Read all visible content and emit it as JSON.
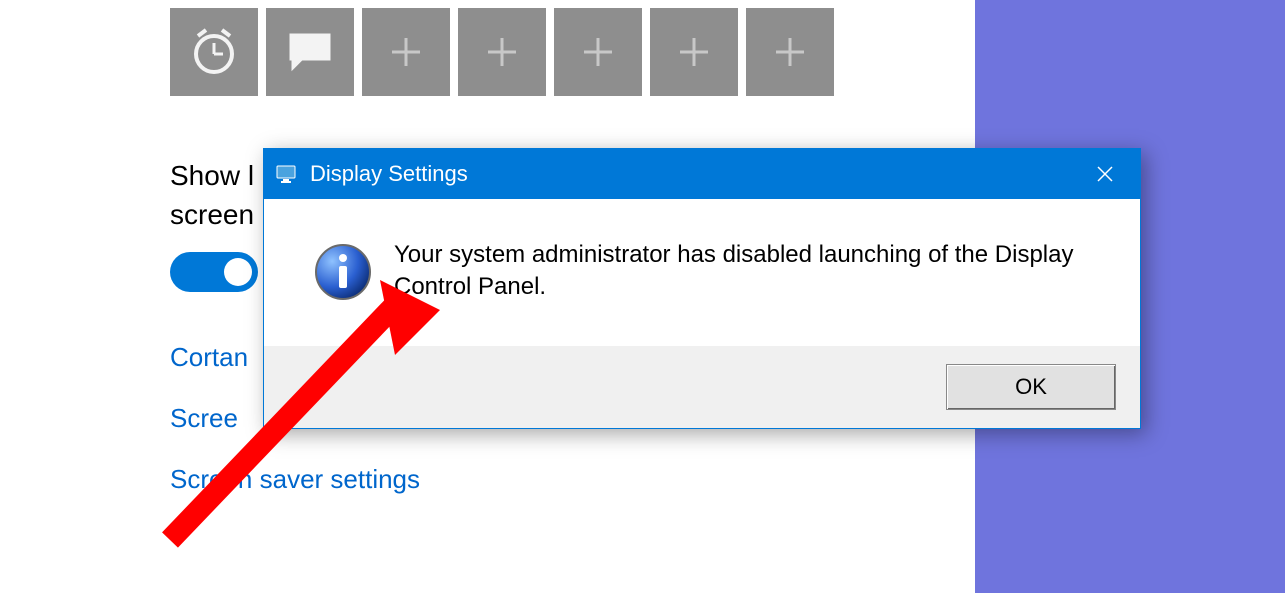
{
  "settings": {
    "partial_label_line1": "Show l",
    "partial_label_line2": "screen",
    "toggle_on": true,
    "links": {
      "cortana": "Cortan",
      "screen": "Scree",
      "screensaver": "Screen saver settings"
    },
    "tiles": [
      {
        "icon": "clock-icon"
      },
      {
        "icon": "comment-icon"
      },
      {
        "icon": "plus-icon"
      },
      {
        "icon": "plus-icon"
      },
      {
        "icon": "plus-icon"
      },
      {
        "icon": "plus-icon"
      },
      {
        "icon": "plus-icon"
      }
    ]
  },
  "dialog": {
    "title": "Display Settings",
    "message": "Your system administrator has disabled launching of the Display Control Panel.",
    "ok_label": "OK"
  }
}
